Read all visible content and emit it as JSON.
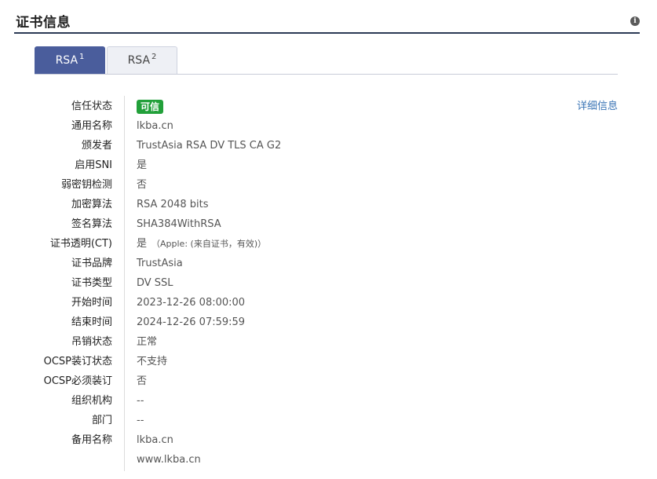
{
  "header": {
    "title": "证书信息",
    "info_icon": "i"
  },
  "tabs": [
    {
      "label": "RSA",
      "num": "1",
      "active": true
    },
    {
      "label": "RSA",
      "num": "2",
      "active": false
    }
  ],
  "detail_link": "详细信息",
  "colors": {
    "active_tab": "#4a5d9c",
    "trusted_badge": "#22a03a",
    "link": "#3a74b5"
  },
  "rows": [
    {
      "label": "信任状态",
      "value": "可信"
    },
    {
      "label": "通用名称",
      "value": "lkba.cn"
    },
    {
      "label": "颁发者",
      "value": "TrustAsia RSA DV TLS CA G2"
    },
    {
      "label": "启用SNI",
      "value": "是"
    },
    {
      "label": "弱密钥检测",
      "value": "否"
    },
    {
      "label": "加密算法",
      "value": "RSA 2048 bits"
    },
    {
      "label": "签名算法",
      "value": "SHA384WithRSA"
    },
    {
      "label": "证书透明(CT)",
      "value": "是",
      "note": "（Apple: (来自证书，有效)）"
    },
    {
      "label": "证书品牌",
      "value": "TrustAsia"
    },
    {
      "label": "证书类型",
      "value": "DV SSL"
    },
    {
      "label": "开始时间",
      "value": "2023-12-26 08:00:00"
    },
    {
      "label": "结束时间",
      "value": "2024-12-26 07:59:59"
    },
    {
      "label": "吊销状态",
      "value": "正常"
    },
    {
      "label": "OCSP装订状态",
      "value": "不支持"
    },
    {
      "label": "OCSP必须装订",
      "value": "否"
    },
    {
      "label": "组织机构",
      "value": "--"
    },
    {
      "label": "部门",
      "value": "--"
    },
    {
      "label": "备用名称",
      "value": "lkba.cn"
    },
    {
      "label": "",
      "value": "www.lkba.cn"
    }
  ]
}
